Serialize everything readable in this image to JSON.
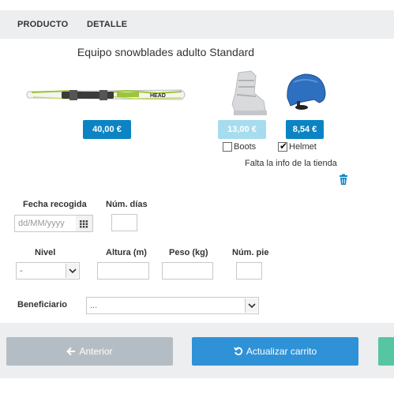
{
  "tabs": [
    {
      "label": "PRODUCTO"
    },
    {
      "label": "DETALLE"
    }
  ],
  "product": {
    "title": "Equipo snowblades adulto Standard",
    "ski_price": "40,00 €",
    "boots_price": "13,00 €",
    "helmet_price": "8,54 €",
    "ski_brand": "HEAD"
  },
  "options": {
    "boots_label": "Boots",
    "boots_checked": false,
    "helmet_label": "Helmet",
    "helmet_checked": true
  },
  "shop_note": "Falta la info de la tienda",
  "form": {
    "pickup_date_label": "Fecha recogida",
    "pickup_date_placeholder": "dd/MM/yyyy",
    "days_label": "Núm. días",
    "level_label": "Nivel",
    "level_value": "-",
    "height_label": "Altura (m)",
    "weight_label": "Peso (kg)",
    "shoe_label": "Núm. pie",
    "beneficiary_label": "Beneficiario",
    "beneficiary_value": "..."
  },
  "footer": {
    "prev_label": "Anterior",
    "update_label": "Actualizar carrito"
  },
  "colors": {
    "primary": "#0c84c3",
    "primary_faded": "#a7dcef",
    "update_button": "#2f92d7",
    "prev_button": "#b5bdc4",
    "next_button": "#55c6a1"
  }
}
